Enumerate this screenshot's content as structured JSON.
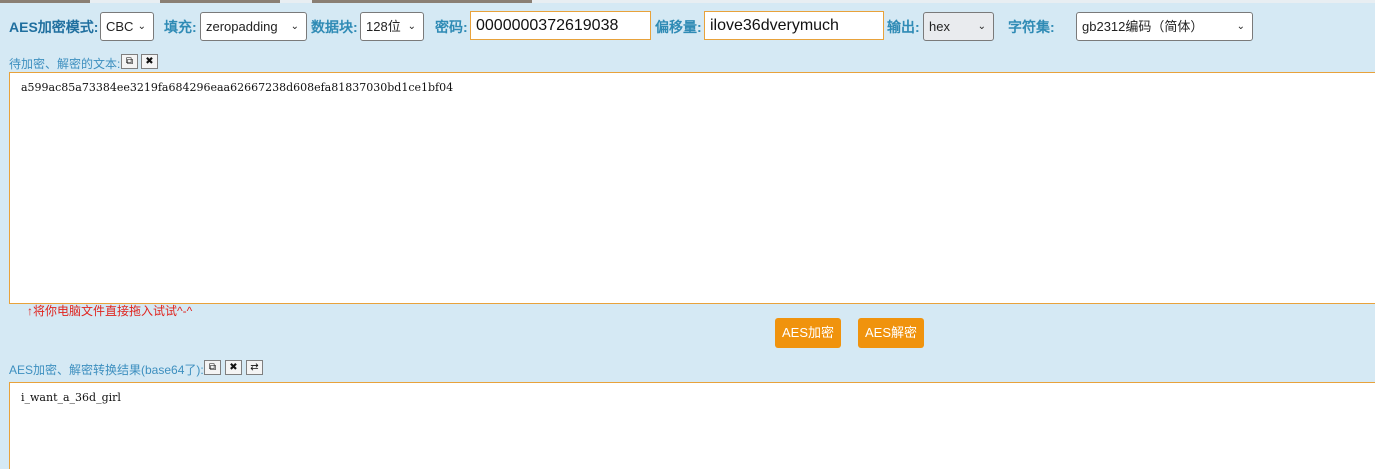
{
  "toolbar": {
    "mode_label": "AES加密模式:",
    "mode_value": "CBC",
    "padding_label": "填充:",
    "padding_value": "zeropadding",
    "block_label": "数据块:",
    "block_value": "128位",
    "key_label": "密码:",
    "key_value": "0000000372619038",
    "iv_label": "偏移量:",
    "iv_value": "ilove36dverymuch",
    "output_label": "输出:",
    "output_value": "hex",
    "charset_label": "字符集:",
    "charset_value": "gb2312编码（简体）"
  },
  "input_section": {
    "label": "待加密、解密的文本:",
    "text": "a599ac85a73384ee3219fa684296eaa62667238d608efa81837030bd1ce1bf04",
    "drag_hint": "↑将你电脑文件直接拖入试试^-^"
  },
  "actions": {
    "encrypt_label": "AES加密",
    "decrypt_label": "AES解密"
  },
  "output_section": {
    "label": "AES加密、解密转换结果(base64了):",
    "text": "i_want_a_36d_girl"
  },
  "icons": [
    "copy-icon",
    "clear-icon",
    "swap-icon",
    "chevron-down-icon"
  ],
  "colors": {
    "background": "#d5e9f4",
    "label_blue": "#2f8bb5",
    "button_orange": "#f0930d",
    "input_border": "#e8a23b",
    "hint_red": "#e0241e"
  }
}
